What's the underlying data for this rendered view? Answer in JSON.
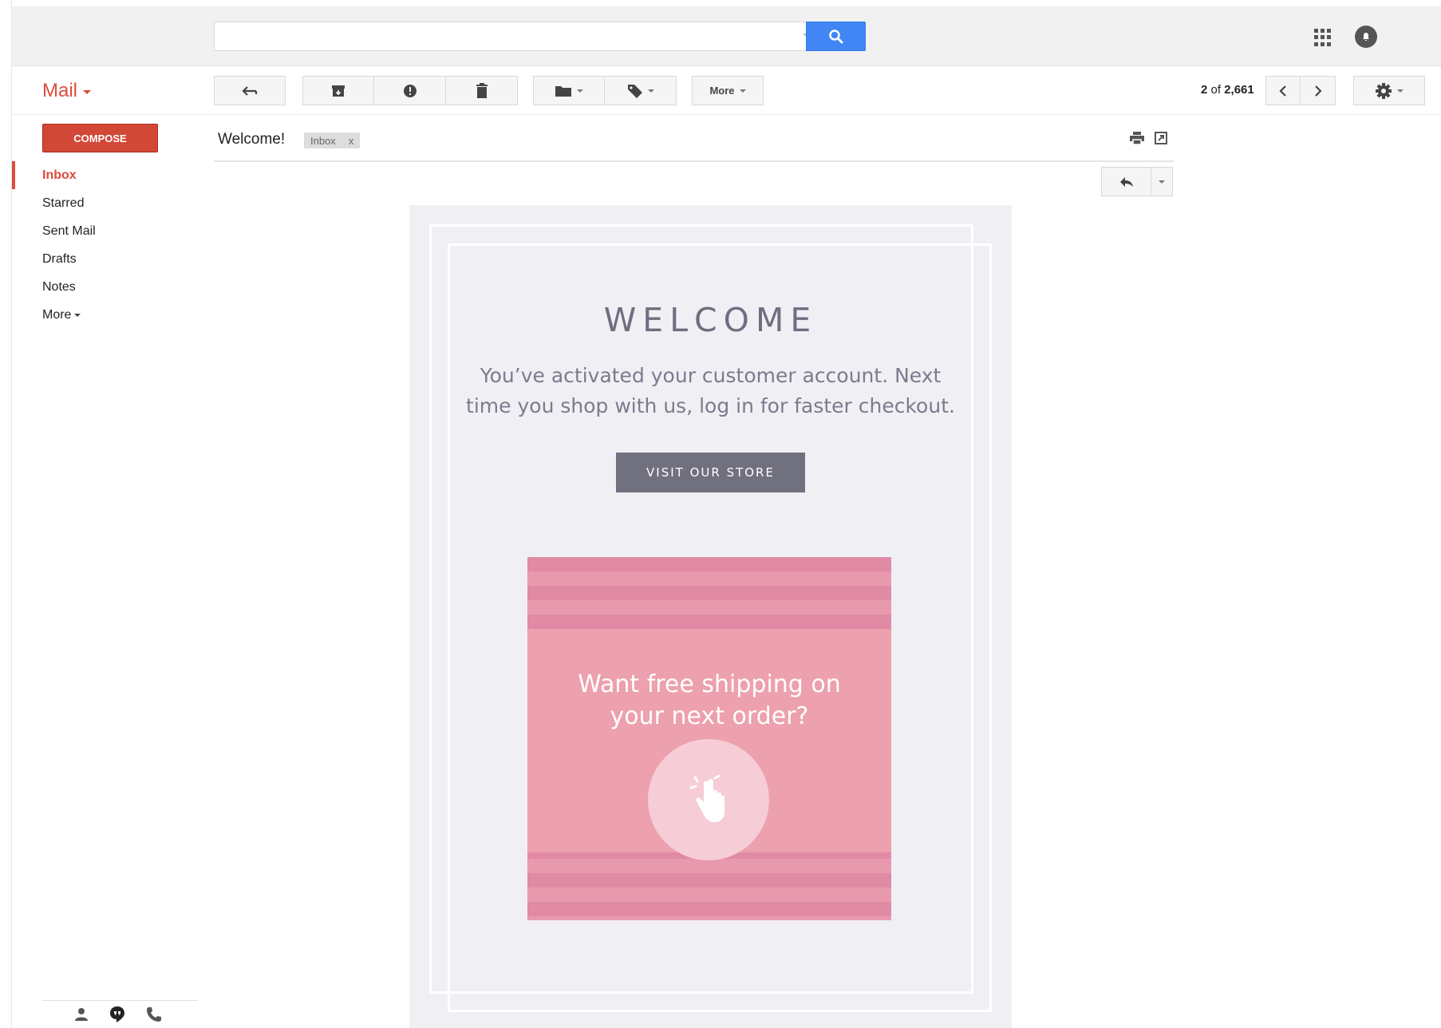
{
  "search": {
    "placeholder": ""
  },
  "app": {
    "title": "Mail"
  },
  "toolbar": {
    "more_label": "More",
    "pager_current": "2",
    "pager_of": "of",
    "pager_total": "2,661"
  },
  "sidebar": {
    "compose_label": "COMPOSE",
    "items": [
      {
        "label": "Inbox",
        "active": true
      },
      {
        "label": "Starred"
      },
      {
        "label": "Sent Mail"
      },
      {
        "label": "Drafts"
      },
      {
        "label": "Notes"
      },
      {
        "label": "More"
      }
    ]
  },
  "message": {
    "subject": "Welcome!",
    "label": "Inbox",
    "label_remove": "x"
  },
  "email": {
    "title": "WELCOME",
    "body": "You’ve activated your customer account. Next time you shop with us, log in for faster checkout.",
    "cta_label": "VISIT OUR STORE",
    "promo_text_line1": "Want free shipping on",
    "promo_text_line2": "your next order?"
  },
  "colors": {
    "accent_red": "#dd4b39",
    "search_blue": "#4285f4",
    "email_bg": "#f0eff4",
    "promo_pink": "#eda0ad"
  },
  "icons": [
    "search-icon",
    "apps-icon",
    "notifications-icon",
    "back-arrow-icon",
    "archive-icon",
    "spam-icon",
    "trash-icon",
    "folder-icon",
    "label-icon",
    "chevron-left-icon",
    "chevron-right-icon",
    "gear-icon",
    "print-icon",
    "new-window-icon",
    "reply-icon",
    "contacts-icon",
    "hangouts-icon",
    "phone-icon",
    "tap-hand-icon"
  ]
}
